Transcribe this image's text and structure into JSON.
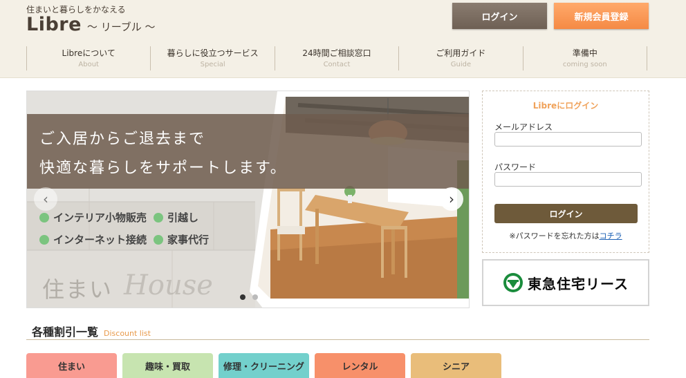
{
  "header": {
    "tagline": "住まいと暮らしをかなえる",
    "logo_name": "Libre",
    "logo_sub": "～ リーブル ～",
    "login_label": "ログイン",
    "register_label": "新規会員登録"
  },
  "nav": [
    {
      "jp": "Libreについて",
      "en": "About"
    },
    {
      "jp": "暮らしに役立つサービス",
      "en": "Special"
    },
    {
      "jp": "24時間ご相談窓口",
      "en": "Contact"
    },
    {
      "jp": "ご利用ガイド",
      "en": "Guide"
    },
    {
      "jp": "準備中",
      "en": "coming soon"
    }
  ],
  "slider": {
    "line1": "ご入居からご退去まで",
    "line2": "快適な暮らしをサポートします。",
    "services": [
      "インテリア小物販売",
      "引越し",
      "インターネット接続",
      "家事代行"
    ],
    "house_jp": "住まい",
    "house_en": "House",
    "prev_icon": "chevron-left-icon",
    "next_icon": "chevron-right-icon",
    "active_dot": 0,
    "dot_count": 2
  },
  "login_box": {
    "title": "Libreにログイン",
    "email_label": "メールアドレス",
    "email_value": "",
    "password_label": "パスワード",
    "password_value": "",
    "button_label": "ログイン",
    "forgot_text": "※パスワードを忘れた方は",
    "forgot_link": "コチラ"
  },
  "sponsor": {
    "name": "東急住宅リース",
    "logo_icon": "tokyu-logo-icon"
  },
  "discount": {
    "title": "各種割引一覧",
    "title_en": "Discount list",
    "tabs": [
      {
        "label": "住まい",
        "color": "#f99b91"
      },
      {
        "label": "趣味・買取",
        "color": "#c7e4b0"
      },
      {
        "label": "修理・クリーニング",
        "color": "#73d0cc"
      },
      {
        "label": "レンタル",
        "color": "#f7906a"
      },
      {
        "label": "シニア",
        "color": "#e9bd7a"
      }
    ]
  },
  "colors": {
    "header_bg": "#f4f0e6",
    "accent_orange": "#f58a45",
    "brown": "#6e5a3a"
  }
}
